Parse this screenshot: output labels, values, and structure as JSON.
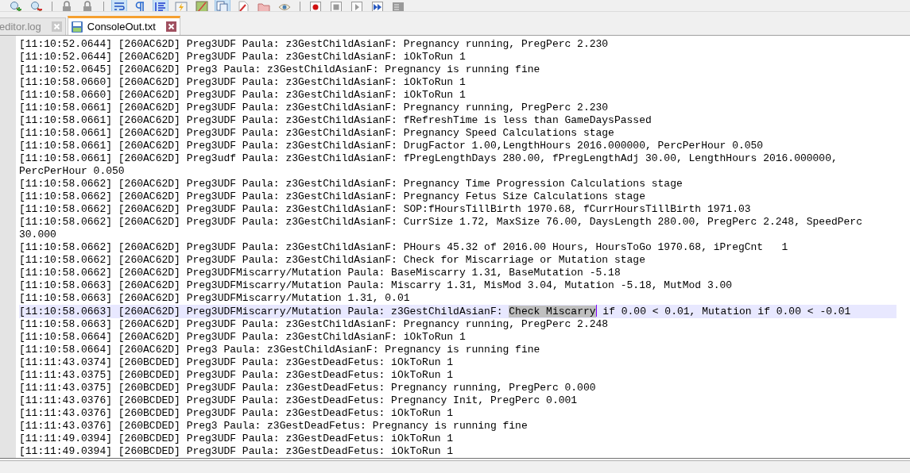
{
  "toolbar": [
    {
      "kind": "zoom-in",
      "on": false
    },
    {
      "kind": "zoom-out",
      "on": false
    },
    {
      "kind": "separator"
    },
    {
      "kind": "lock",
      "on": false
    },
    {
      "kind": "lock",
      "on": false
    },
    {
      "kind": "separator"
    },
    {
      "kind": "wrap",
      "on": true
    },
    {
      "kind": "pilcrow",
      "on": false
    },
    {
      "kind": "indent",
      "on": true
    },
    {
      "kind": "lightning",
      "on": false
    },
    {
      "kind": "map",
      "on": false
    },
    {
      "kind": "documents",
      "on": true
    },
    {
      "kind": "pen",
      "on": false
    },
    {
      "kind": "folder",
      "on": false
    },
    {
      "kind": "eye",
      "on": false
    },
    {
      "kind": "separator"
    },
    {
      "kind": "record",
      "on": false
    },
    {
      "kind": "stop",
      "on": false
    },
    {
      "kind": "play",
      "on": false
    },
    {
      "kind": "fast-forward",
      "on": false
    },
    {
      "kind": "macro",
      "on": false
    }
  ],
  "tabs": [
    {
      "label": "editor.log",
      "selected": false
    },
    {
      "label": "ConsoleOut.txt",
      "selected": true
    }
  ],
  "lines": [
    {
      "text": "[11:10:52.0644] [260AC62D] Preg3UDF Paula: z3GestChildAsianF: Pregnancy running, PregPerc 2.230",
      "current": false
    },
    {
      "text": "[11:10:52.0644] [260AC62D] Preg3UDF Paula: z3GestChildAsianF: iOkToRun 1",
      "current": false
    },
    {
      "text": "[11:10:52.0645] [260AC62D] Preg3 Paula: z3GestChildAsianF: Pregnancy is running fine",
      "current": false
    },
    {
      "text": "[11:10:58.0660] [260AC62D] Preg3UDF Paula: z3GestChildAsianF: iOkToRun 1",
      "current": false
    },
    {
      "text": "[11:10:58.0660] [260AC62D] Preg3UDF Paula: z3GestChildAsianF: iOkToRun 1",
      "current": false
    },
    {
      "text": "[11:10:58.0661] [260AC62D] Preg3UDF Paula: z3GestChildAsianF: Pregnancy running, PregPerc 2.230",
      "current": false
    },
    {
      "text": "[11:10:58.0661] [260AC62D] Preg3UDF Paula: z3GestChildAsianF: fRefreshTime is less than GameDaysPassed",
      "current": false
    },
    {
      "text": "[11:10:58.0661] [260AC62D] Preg3UDF Paula: z3GestChildAsianF: Pregnancy Speed Calculations stage",
      "current": false
    },
    {
      "text": "[11:10:58.0661] [260AC62D] Preg3UDF Paula: z3GestChildAsianF: DrugFactor 1.00,LengthHours 2016.000000, PercPerHour 0.050",
      "current": false
    },
    {
      "text": "[11:10:58.0661] [260AC62D] Preg3udf Paula: z3GestChildAsianF: fPregLengthDays 280.00, fPregLengthAdj 30.00, LengthHours 2016.000000, PercPerHour 0.050",
      "current": false
    },
    {
      "text": "[11:10:58.0662] [260AC62D] Preg3UDF Paula: z3GestChildAsianF: Pregnancy Time Progression Calculations stage",
      "current": false
    },
    {
      "text": "[11:10:58.0662] [260AC62D] Preg3UDF Paula: z3GestChildAsianF: Pregnancy Fetus Size Calculations stage",
      "current": false
    },
    {
      "text": "[11:10:58.0662] [260AC62D] Preg3UDF Paula: z3GestChildAsianF: SOP:fHoursTillBirth 1970.68, fCurrHoursTillBirth 1971.03",
      "current": false
    },
    {
      "text": "[11:10:58.0662] [260AC62D] Preg3UDF Paula: z3GestChildAsianF: CurrSize 1.72, MaxSize 76.00, DaysLength 280.00, PregPerc 2.248, SpeedPerc 30.000",
      "current": false
    },
    {
      "text": "[11:10:58.0662] [260AC62D] Preg3UDF Paula: z3GestChildAsianF: PHours 45.32 of 2016.00 Hours, HoursToGo 1970.68, iPregCnt   1",
      "current": false
    },
    {
      "text": "[11:10:58.0662] [260AC62D] Preg3UDF Paula: z3GestChildAsianF: Check for Miscarriage or Mutation stage",
      "current": false
    },
    {
      "text": "[11:10:58.0662] [260AC62D] Preg3UDFMiscarry/Mutation Paula: BaseMiscarry 1.31, BaseMutation -5.18",
      "current": false
    },
    {
      "text": "[11:10:58.0663] [260AC62D] Preg3UDFMiscarry/Mutation Paula: Miscarry 1.31, MisMod 3.04, Mutation -5.18, MutMod 3.00",
      "current": false
    },
    {
      "text": "[11:10:58.0663] [260AC62D] Preg3UDFMiscarry/Mutation 1.31, 0.01",
      "current": false
    },
    {
      "current": true,
      "segments": [
        {
          "text": "[11:10:58.0663] [260AC62D] Preg3UDFMiscarry/Mutation Paula: z3GestChildAsianF: ",
          "selected": false
        },
        {
          "text": "Check Miscarry",
          "selected": true
        },
        {
          "text": " if 0.00 < 0.01, Mutation if 0.00 < -0.01",
          "selected": false
        }
      ]
    },
    {
      "text": "[11:10:58.0663] [260AC62D] Preg3UDF Paula: z3GestChildAsianF: Pregnancy running, PregPerc 2.248",
      "current": false
    },
    {
      "text": "[11:10:58.0664] [260AC62D] Preg3UDF Paula: z3GestChildAsianF: iOkToRun 1",
      "current": false
    },
    {
      "text": "[11:10:58.0664] [260AC62D] Preg3 Paula: z3GestChildAsianF: Pregnancy is running fine",
      "current": false
    },
    {
      "text": "[11:11:43.0374] [260BCDED] Preg3UDF Paula: z3GestDeadFetus: iOkToRun 1",
      "current": false
    },
    {
      "text": "[11:11:43.0375] [260BCDED] Preg3UDF Paula: z3GestDeadFetus: iOkToRun 1",
      "current": false
    },
    {
      "text": "[11:11:43.0375] [260BCDED] Preg3UDF Paula: z3GestDeadFetus: Pregnancy running, PregPerc 0.000",
      "current": false
    },
    {
      "text": "[11:11:43.0376] [260BCDED] Preg3UDF Paula: z3GestDeadFetus: Pregnancy Init, PregPerc 0.001",
      "current": false
    },
    {
      "text": "[11:11:43.0376] [260BCDED] Preg3UDF Paula: z3GestDeadFetus: iOkToRun 1",
      "current": false
    },
    {
      "text": "[11:11:43.0376] [260BCDED] Preg3 Paula: z3GestDeadFetus: Pregnancy is running fine",
      "current": false
    },
    {
      "text": "[11:11:49.0394] [260BCDED] Preg3UDF Paula: z3GestDeadFetus: iOkToRun 1",
      "current": false
    },
    {
      "text": "[11:11:49.0394] [260BCDED] Preg3UDF Paula: z3GestDeadFetus: iOkToRun 1",
      "current": false
    }
  ]
}
